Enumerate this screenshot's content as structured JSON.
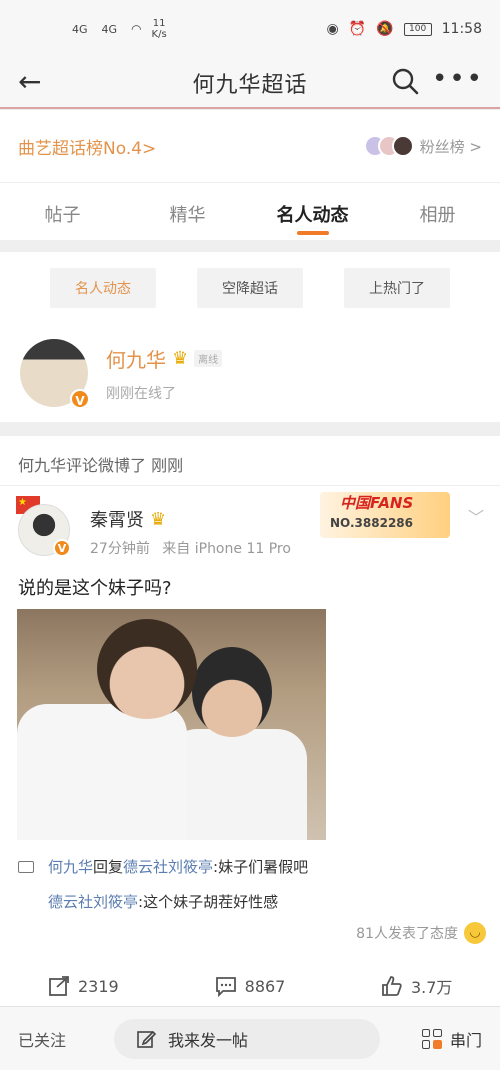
{
  "status_bar": {
    "signal1": "4G",
    "signal2": "4G",
    "speed_value": "11",
    "speed_unit": "K/s",
    "battery": "100",
    "time": "11:58"
  },
  "nav": {
    "title": "何九华超话"
  },
  "rank": {
    "label": "曲艺超话榜No.4>",
    "fans_label": "粉丝榜 >"
  },
  "tabs": [
    {
      "label": "帖子"
    },
    {
      "label": "精华"
    },
    {
      "label": "名人动态"
    },
    {
      "label": "相册"
    }
  ],
  "filters": [
    {
      "label": "名人动态"
    },
    {
      "label": "空降超话"
    },
    {
      "label": "上热门了"
    }
  ],
  "profile": {
    "name": "何九华",
    "offline_badge": "离线",
    "status": "刚刚在线了"
  },
  "activity": {
    "text": "何九华评论微博了 刚刚"
  },
  "post": {
    "author": "秦霄贤",
    "time": "27分钟前",
    "source": "来自 iPhone 11 Pro",
    "badge_title": "中国FANS",
    "badge_number": "NO.3882286",
    "text": "说的是这个妹子吗?",
    "comments": [
      {
        "user": "何九华",
        "verb": "回复",
        "target": "德云社刘筱亭",
        "body": ":妹子们暑假吧"
      },
      {
        "user": "德云社刘筱亭",
        "body": ":这个妹子胡茬好性感"
      }
    ],
    "reaction_text": "81人发表了态度"
  },
  "actions": {
    "repost": "2319",
    "comment": "8867",
    "like": "3.7万"
  },
  "bottom": {
    "follow": "已关注",
    "compose": "我来发一帖",
    "serial": "串门"
  },
  "colors": {
    "accent": "#f07c2a",
    "highlight": "#e3934b",
    "link": "#5b7db1"
  }
}
